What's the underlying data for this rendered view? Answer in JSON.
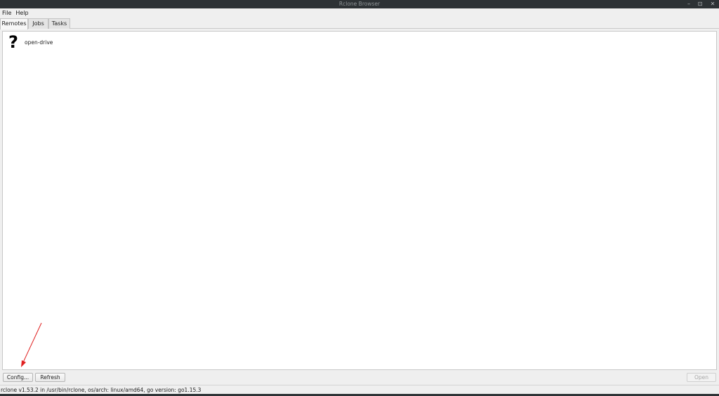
{
  "window": {
    "title": "Rclone Browser",
    "controls": {
      "minimize": "–",
      "restore": "⊡",
      "close": "✕"
    }
  },
  "menubar": {
    "items": [
      "File",
      "Help"
    ]
  },
  "tabs": [
    {
      "label": "Remotes",
      "active": true
    },
    {
      "label": "Jobs",
      "active": false
    },
    {
      "label": "Tasks",
      "active": false
    }
  ],
  "remotes": [
    {
      "name": "open-drive",
      "icon": "unknown-remote-icon",
      "glyph": "?"
    }
  ],
  "buttons": {
    "config": "Config...",
    "refresh": "Refresh",
    "open": "Open",
    "open_enabled": false
  },
  "statusbar": {
    "text": "rclone v1.53.2 in /usr/bin/rclone, os/arch: linux/amd64, go version: go1.15.3"
  },
  "annotation": {
    "color": "#e02020",
    "target": "config-button"
  },
  "colors": {
    "titlebar": "#2d3235",
    "panel": "#ffffff",
    "background": "#efefef"
  }
}
